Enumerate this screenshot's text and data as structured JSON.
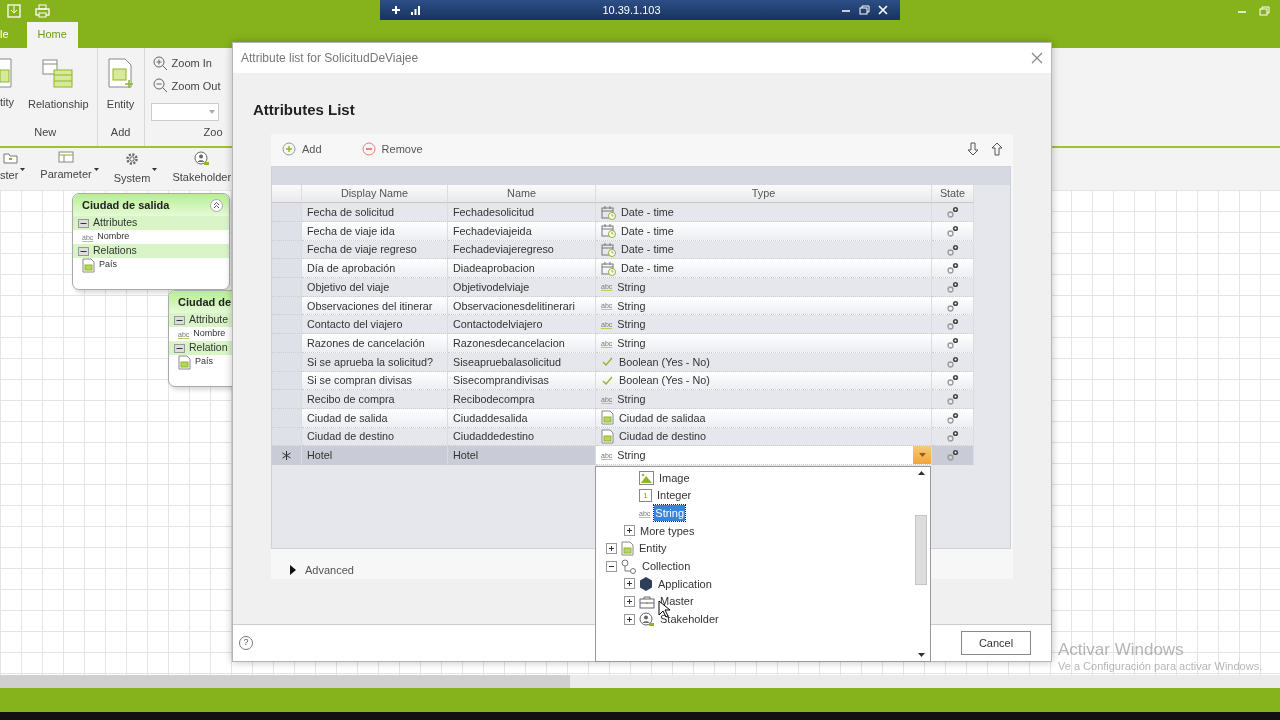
{
  "ribbon_tabs": [
    {
      "label": "le",
      "selected": false
    },
    {
      "label": "Home",
      "selected": true
    }
  ],
  "ribbon_groups": [
    {
      "label": "New",
      "buttons": [
        {
          "kind": "entity",
          "label": "tity"
        },
        {
          "kind": "relationship",
          "label": "Relationship"
        }
      ]
    },
    {
      "label": "Add",
      "buttons": [
        {
          "kind": "add_entity",
          "label": "Entity"
        }
      ]
    },
    {
      "label": "Zoo",
      "buttons": [
        {
          "kind": "zoom_in",
          "label": "Zoom In"
        },
        {
          "kind": "zoom_out",
          "label": "Zoom Out"
        }
      ]
    }
  ],
  "tool_buttons": [
    {
      "kind": "master",
      "label": "ster",
      "dropdown": true
    },
    {
      "kind": "parameter",
      "label": "Parameter",
      "dropdown": true
    },
    {
      "kind": "system",
      "label": "System",
      "dropdown": true
    },
    {
      "kind": "stakeholder",
      "label": "Stakeholder",
      "dropdown": false
    }
  ],
  "canvas_cards": [
    {
      "title": "Ciudad de salida",
      "collapsible": true,
      "sections": [
        {
          "label": "Attributes",
          "expanded": true,
          "items": [
            {
              "kind": "string",
              "icon_label": "abc",
              "label": "Nombre"
            }
          ]
        },
        {
          "label": "Relations",
          "expanded": true,
          "items": [
            {
              "kind": "entity",
              "label": "País"
            }
          ]
        }
      ]
    },
    {
      "title": "Ciudad de",
      "collapsible": false,
      "sections": [
        {
          "label": "Attribute",
          "expanded": true,
          "items": [
            {
              "kind": "string",
              "icon_label": "abc",
              "label": "Nombre"
            }
          ]
        },
        {
          "label": "Relation",
          "expanded": true,
          "items": [
            {
              "kind": "entity",
              "label": "País"
            }
          ]
        }
      ]
    }
  ],
  "remote_bar": {
    "title": "10.39.1.103"
  },
  "dialog": {
    "title": "Attribute list for SolicitudDeViajee",
    "heading": "Attributes List",
    "toolbar": [
      {
        "kind": "add",
        "label": "Add"
      },
      {
        "kind": "remove",
        "label": "Remove"
      }
    ],
    "columns": [
      "Display Name",
      "Name",
      "Type",
      "State"
    ],
    "rows": [
      {
        "display_name": "Fecha de solicitud",
        "name": "Fechadesolicitud",
        "type": {
          "kind": "datetime",
          "label": "Date - time"
        },
        "selected": false,
        "new": false
      },
      {
        "display_name": "Fecha de viaje ida",
        "name": "Fechadeviajeida",
        "type": {
          "kind": "datetime",
          "label": "Date - time"
        },
        "selected": false,
        "new": false
      },
      {
        "display_name": "Fecha de viaje regreso",
        "name": "Fechadeviajeregreso",
        "type": {
          "kind": "datetime",
          "label": "Date - time"
        },
        "selected": false,
        "new": false
      },
      {
        "display_name": "Día de aprobación",
        "name": "Diadeaprobacion",
        "type": {
          "kind": "datetime",
          "label": "Date - time"
        },
        "selected": false,
        "new": false
      },
      {
        "display_name": "Objetivo del viaje",
        "name": "Objetivodelviaje",
        "type": {
          "kind": "string",
          "icon_label": "abc",
          "label": "String"
        },
        "selected": false,
        "new": false
      },
      {
        "display_name": "Observaciones del itinerar",
        "name": "Observacionesdelitinerari",
        "type": {
          "kind": "string",
          "icon_label": "abc",
          "label": "String"
        },
        "selected": false,
        "new": false
      },
      {
        "display_name": "Contacto del viajero",
        "name": "Contactodelviajero",
        "type": {
          "kind": "string",
          "icon_label": "abc",
          "label": "String"
        },
        "selected": false,
        "new": false
      },
      {
        "display_name": "Razones de cancelación",
        "name": "Razonesdecancelacion",
        "type": {
          "kind": "string",
          "icon_label": "abc",
          "label": "String"
        },
        "selected": false,
        "new": false
      },
      {
        "display_name": "Si se aprueba la solicitud?",
        "name": "Siseapruebalasolicitud",
        "type": {
          "kind": "boolean",
          "label": "Boolean (Yes - No)"
        },
        "selected": false,
        "new": false
      },
      {
        "display_name": "Si se compran divisas",
        "name": "Sisecomprandivisas",
        "type": {
          "kind": "boolean",
          "label": "Boolean (Yes - No)"
        },
        "selected": false,
        "new": false
      },
      {
        "display_name": "Recibo de compra",
        "name": "Recibodecompra",
        "type": {
          "kind": "string",
          "icon_label": "abc",
          "label": "String"
        },
        "selected": false,
        "new": false
      },
      {
        "display_name": "Ciudad de salida",
        "name": "Ciudaddesalida",
        "type": {
          "kind": "entity",
          "label": "Ciudad de salidaa"
        },
        "selected": false,
        "new": false
      },
      {
        "display_name": "Ciudad de destino",
        "name": "Ciudaddedestino",
        "type": {
          "kind": "entity",
          "label": "Ciudad de destino"
        },
        "selected": false,
        "new": false
      },
      {
        "display_name": "Hotel",
        "name": "Hotel",
        "type": {
          "kind": "string",
          "icon_label": "abc",
          "label": "String"
        },
        "selected": true,
        "new": true
      }
    ],
    "advanced": {
      "label": "Advanced",
      "expanded": false
    },
    "help_glyph": "?",
    "buttons": [
      {
        "label": "Cancel"
      }
    ]
  },
  "type_dropdown": {
    "tree": [
      {
        "children": [
          {
            "kind": "image",
            "label": "Image",
            "selected": false
          },
          {
            "kind": "integer",
            "icon_label": "1",
            "label": "Integer",
            "selected": false
          },
          {
            "kind": "string",
            "icon_label": "abc",
            "label": "String",
            "selected": true
          },
          {
            "kind": "group",
            "label": "More types",
            "selected": false,
            "expanded": false
          }
        ]
      },
      {
        "kind": "entity",
        "label": "Entity",
        "selected": false,
        "expanded": false
      },
      {
        "kind": "collection",
        "label": "Collection",
        "selected": false,
        "expanded": true,
        "children": [
          {
            "kind": "application",
            "label": "Application",
            "selected": false,
            "expanded": false
          },
          {
            "kind": "master",
            "label": "Master",
            "selected": false,
            "expanded": false
          },
          {
            "kind": "stakeholder",
            "label": "Stakeholder",
            "selected": false,
            "expanded": false
          }
        ]
      }
    ]
  },
  "watermark": {
    "title": "Activar Windows",
    "subtitle": "Ve a Configuración para activar Windows."
  }
}
